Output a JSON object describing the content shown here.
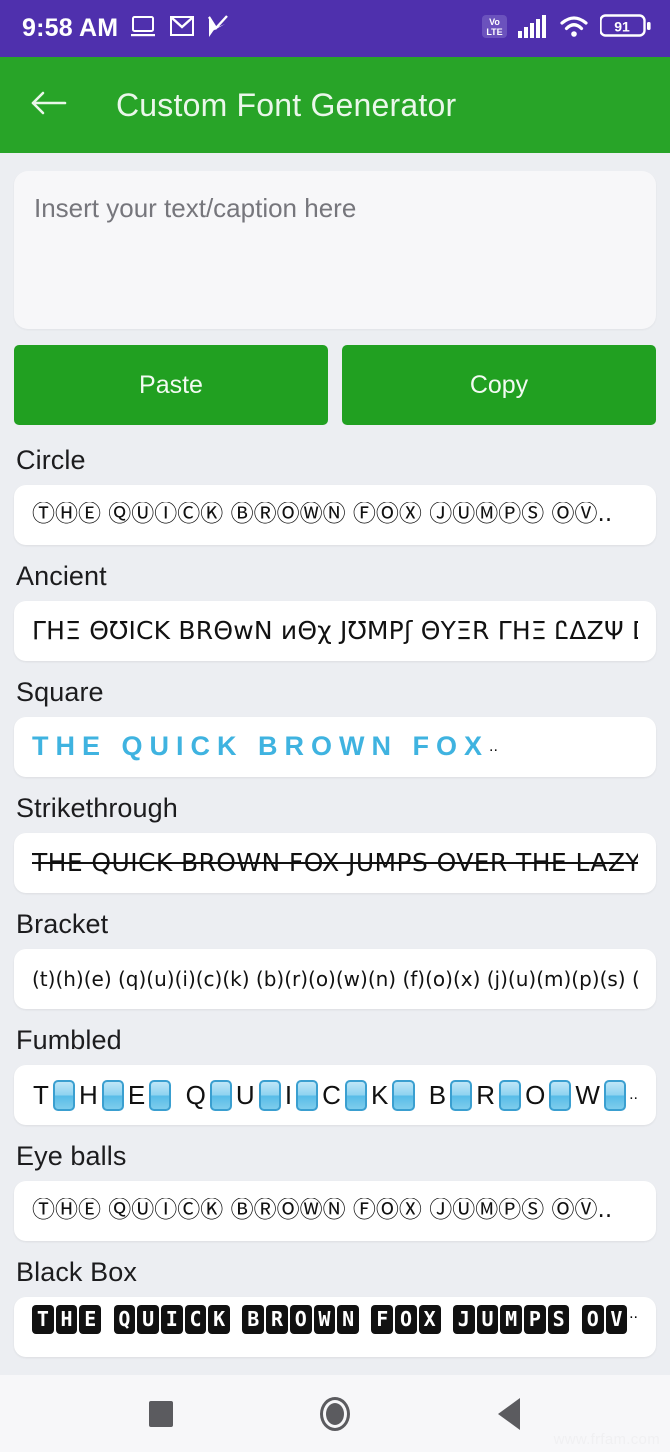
{
  "status_bar": {
    "time": "9:58 AM",
    "battery_percent": "91",
    "network_label": "VoLTE",
    "icons": [
      "cast-screen-icon",
      "gmail-icon",
      "checkmark-flag-icon",
      "volte-icon",
      "signal-bars-icon",
      "wifi-icon",
      "battery-icon"
    ],
    "background_color": "#4f30ad"
  },
  "app_bar": {
    "title": "Custom Font Generator",
    "back_icon": "back-arrow-icon",
    "background_color": "#28a428"
  },
  "editor": {
    "placeholder": "Insert your text/caption here",
    "value": ""
  },
  "actions": {
    "paste_label": "Paste",
    "copy_label": "Copy",
    "button_color": "#21a021"
  },
  "font_styles": [
    {
      "label": "Circle",
      "sample": "ⓉⒽⒺ ⓆⓊⒾⒸⓀ ⒷⓇⓄⓌⓃ ⒻⓄⓍ ⒿⓊⓂⓅⓈ ⓄⓋ.."
    },
    {
      "label": "Ancient",
      "sample": "ΓΗΞ ΘƱICK BRΘwN ᴎΘχ JƱMPʃ ΘYΞR ΓΗΞ ᏝΔZΨ DΘG"
    },
    {
      "label": "Square",
      "sample": "THE QUICK BROWN FOX",
      "trailing": "..",
      "color": "#3fb3e0"
    },
    {
      "label": "Strikethrough",
      "sample": "THE QUICK BROWN FOX JUMPS OVER THE LAZY.."
    },
    {
      "label": "Bracket",
      "sample": "(t)(h)(e) (q)(u)(i)(c)(k) (b)(r)(o)(w)(n) (f)(o)(x) (j)(u)(m)(p)(s) (o)(v).."
    },
    {
      "label": "Fumbled",
      "letters": [
        "T",
        "",
        "H",
        "",
        "E",
        "",
        " ",
        "Q",
        "",
        "U",
        "",
        "I",
        "",
        "C",
        "",
        "K",
        "",
        " ",
        "B",
        "",
        "R",
        "",
        "O",
        "",
        "W",
        ""
      ],
      "trailing": ".."
    },
    {
      "label": "Eye balls",
      "sample": "ⓉⒽⒺ ⓆⓊⒾⒸⓀ ⒷⓇⓄⓌⓃ ⒻⓄⓍ ⒿⓊⓂⓅⓈ ⓄⓋ.."
    },
    {
      "label": "Black Box",
      "boxes": [
        "T",
        "H",
        "E",
        "|",
        "Q",
        "U",
        "I",
        "C",
        "K",
        "|",
        "B",
        "R",
        "O",
        "W",
        "N",
        "|",
        "F",
        "O",
        "X",
        "|",
        "J",
        "U",
        "M",
        "P",
        "S",
        "|",
        "O",
        "V"
      ],
      "trailing": ".."
    }
  ],
  "nav_bar": {
    "recents_icon": "square-recents-icon",
    "home_icon": "circle-home-icon",
    "back_icon": "triangle-back-icon"
  },
  "watermark": "www.frfam.com"
}
